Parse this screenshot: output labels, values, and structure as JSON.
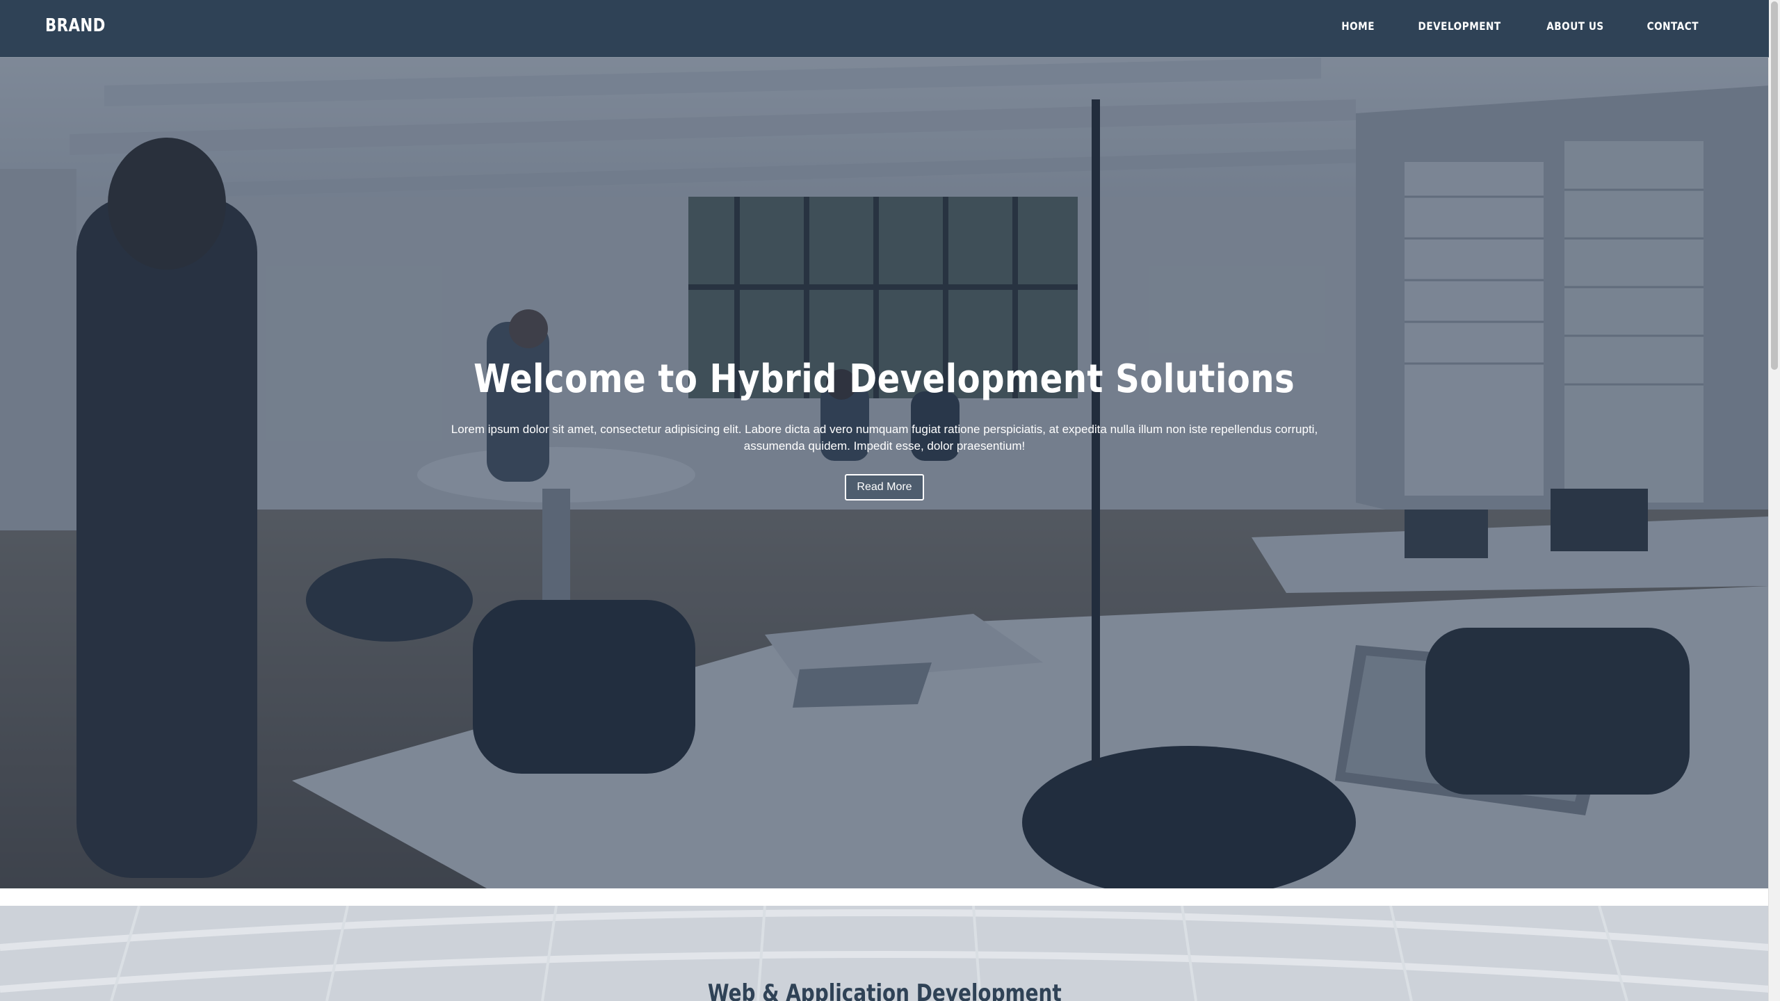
{
  "navbar": {
    "brand": "BRAND",
    "links": [
      "HOME",
      "DEVELOPMENT",
      "ABOUT US",
      "CONTACT"
    ]
  },
  "hero": {
    "title": "Welcome to Hybrid Development Solutions",
    "text": "Lorem ipsum dolor sit amet, consectetur adipisicing elit. Labore dicta ad vero numquam fugiat ratione perspiciatis, at expedita nulla illum non iste repellendus corrupti, assumenda quidem. Impedit esse, dolor praesentium!",
    "button_label": "Read More",
    "overlay_color": "#263750"
  },
  "section2": {
    "title": "Web & Application Development"
  },
  "colors": {
    "navbar_bg": "#2f4256",
    "text_light": "#ffffff",
    "section_title": "#2f4256"
  }
}
